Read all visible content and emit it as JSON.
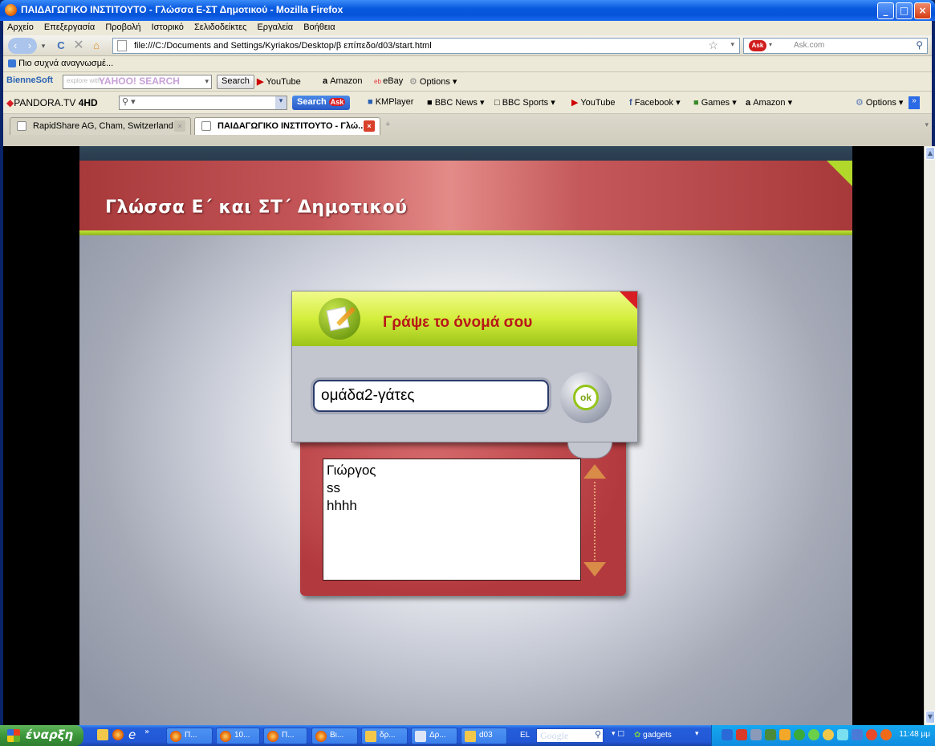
{
  "window": {
    "title": "ΠΑΙΔΑΓΩΓΙΚΟ ΙΝΣΤΙΤΟΥΤΟ - Γλώσσα Ε-ΣΤ Δημοτικού - Mozilla Firefox",
    "minimize": "_",
    "maximize": "□",
    "close": "×"
  },
  "menu": [
    "Αρχείο",
    "Επεξεργασία",
    "Προβολή",
    "Ιστορικό",
    "Σελιδοδείκτες",
    "Εργαλεία",
    "Βοήθεια"
  ],
  "nav": {
    "url": "file:///C:/Documents and Settings/Kyriakos/Desktop/β επίπεδο/d03/start.html",
    "search_engine": "Ask",
    "search_placeholder": "Ask.com"
  },
  "bookmarks": {
    "most_visited": "Πιο συχνά αναγνωσμέ..."
  },
  "yahoo_bar": {
    "brand": "BienneSoft",
    "search_placeholder": "explore with",
    "yahoo_label": "YAHOO! SEARCH",
    "search_button": "Search",
    "links": [
      "YouTube",
      "Amazon",
      "eBay",
      "Options"
    ]
  },
  "pandora_bar": {
    "brand": "PANDORA.TV",
    "brand_suffix": "4HD",
    "search_button": "Search",
    "links": [
      "KMPlayer",
      "BBC News",
      "BBC Sports",
      "YouTube",
      "Facebook",
      "Games",
      "Amazon"
    ],
    "options": "Options"
  },
  "tabs": [
    {
      "label": "RapidShare AG, Cham, Switzerland"
    },
    {
      "label": "ΠΑΙΔΑΓΩΓΙΚΟ ΙΝΣΤΙΤΟΥΤΟ - Γλώ..."
    }
  ],
  "page": {
    "header_title": "Γλώσσα Ε΄ και ΣΤ΄ Δημοτικού",
    "dialog_title": "Γράψε το όνομά σου",
    "name_value": "ομάδα2-γάτες",
    "ok_label": "ok",
    "names": [
      "Γιώργος",
      "ss",
      "hhhh"
    ]
  },
  "taskbar": {
    "start": "έναρξη",
    "buttons": [
      "Π...",
      "10...",
      "Π...",
      "Βι...",
      "δρ...",
      "Δρ...",
      "d03"
    ],
    "lang": "EL",
    "google": "Google",
    "gadgets": "gadgets",
    "clock": "11:48 μμ"
  }
}
